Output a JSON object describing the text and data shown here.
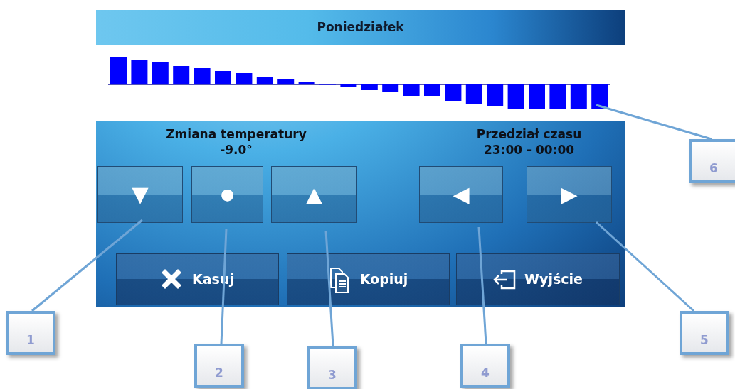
{
  "screen": {
    "title": "Poniedziałek",
    "temperature": {
      "label": "Zmiana temperatury",
      "value": "-9.0°",
      "buttons": [
        {
          "symbol": "▼"
        },
        {
          "symbol": "●"
        },
        {
          "symbol": "▲"
        }
      ]
    },
    "time": {
      "label": "Przedział czasu",
      "value": "23:00 - 00:00",
      "buttons": [
        {
          "symbol": "◀"
        },
        {
          "symbol": "▶"
        }
      ]
    },
    "actions": [
      {
        "label": "Kasuj",
        "kind": "delete"
      },
      {
        "label": "Kopiuj",
        "kind": "copy"
      },
      {
        "label": "Wyjście",
        "kind": "exit"
      }
    ]
  },
  "callouts": [
    {
      "number": "1"
    },
    {
      "number": "2"
    },
    {
      "number": "3"
    },
    {
      "number": "4"
    },
    {
      "number": "5"
    },
    {
      "number": "6"
    }
  ]
}
